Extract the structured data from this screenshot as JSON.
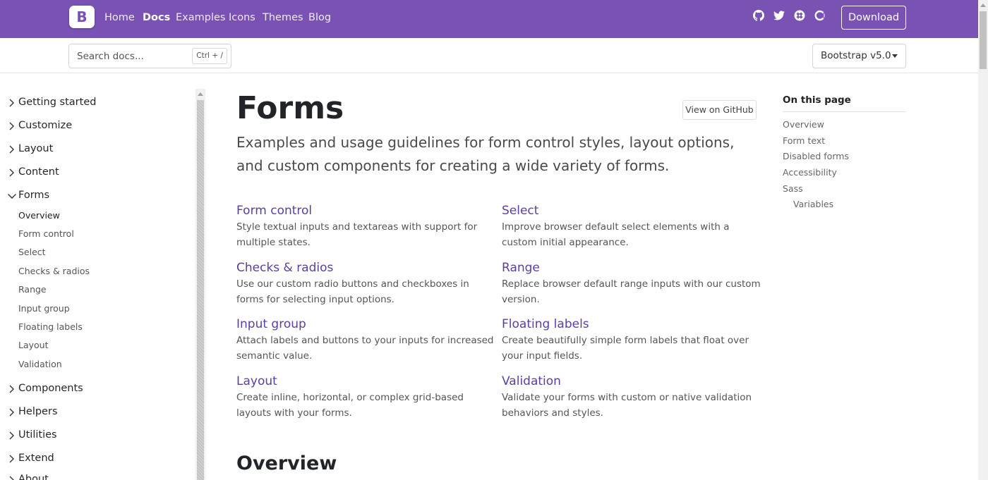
{
  "navbar": {
    "brand": "B",
    "links": [
      "Home",
      "Docs",
      "Examples",
      "Icons",
      "Themes",
      "Blog"
    ],
    "active": "Docs",
    "icons": [
      "github-icon",
      "twitter-icon",
      "slack-icon",
      "opencollective-icon"
    ],
    "download_label": "Download",
    "accent_color": "#7952b3"
  },
  "search": {
    "placeholder": "Search docs...",
    "shortcut": "Ctrl + /"
  },
  "version": {
    "selected": "Bootstrap v5.0"
  },
  "sidebar": {
    "groups_top": [
      "Getting started",
      "Customize",
      "Layout",
      "Content"
    ],
    "open_group": "Forms",
    "forms_items": [
      "Overview",
      "Form control",
      "Select",
      "Checks & radios",
      "Range",
      "Input group",
      "Floating labels",
      "Layout",
      "Validation"
    ],
    "active_item": "Overview",
    "groups_bottom": [
      "Components",
      "Helpers",
      "Utilities",
      "Extend",
      "About"
    ]
  },
  "main": {
    "title": "Forms",
    "github_button": "View on GitHub",
    "lead": "Examples and usage guidelines for form control styles, layout options, and custom components for creating a wide variety of forms.",
    "cards": [
      {
        "title": "Form control",
        "desc": "Style textual inputs and textareas with support for multiple states."
      },
      {
        "title": "Select",
        "desc": "Improve browser default select elements with a custom initial appearance."
      },
      {
        "title": "Checks & radios",
        "desc": "Use our custom radio buttons and checkboxes in forms for selecting input options."
      },
      {
        "title": "Range",
        "desc": "Replace browser default range inputs with our custom version."
      },
      {
        "title": "Input group",
        "desc": "Attach labels and buttons to your inputs for increased semantic value."
      },
      {
        "title": "Floating labels",
        "desc": "Create beautifully simple form labels that float over your input fields."
      },
      {
        "title": "Layout",
        "desc": "Create inline, horizontal, or complex grid-based layouts with your forms."
      },
      {
        "title": "Validation",
        "desc": "Validate your forms with custom or native validation behaviors and styles."
      }
    ],
    "section_title": "Overview"
  },
  "toc": {
    "heading": "On this page",
    "items": [
      "Overview",
      "Form text",
      "Disabled forms",
      "Accessibility",
      "Sass"
    ],
    "sub_items": [
      "Variables"
    ]
  }
}
